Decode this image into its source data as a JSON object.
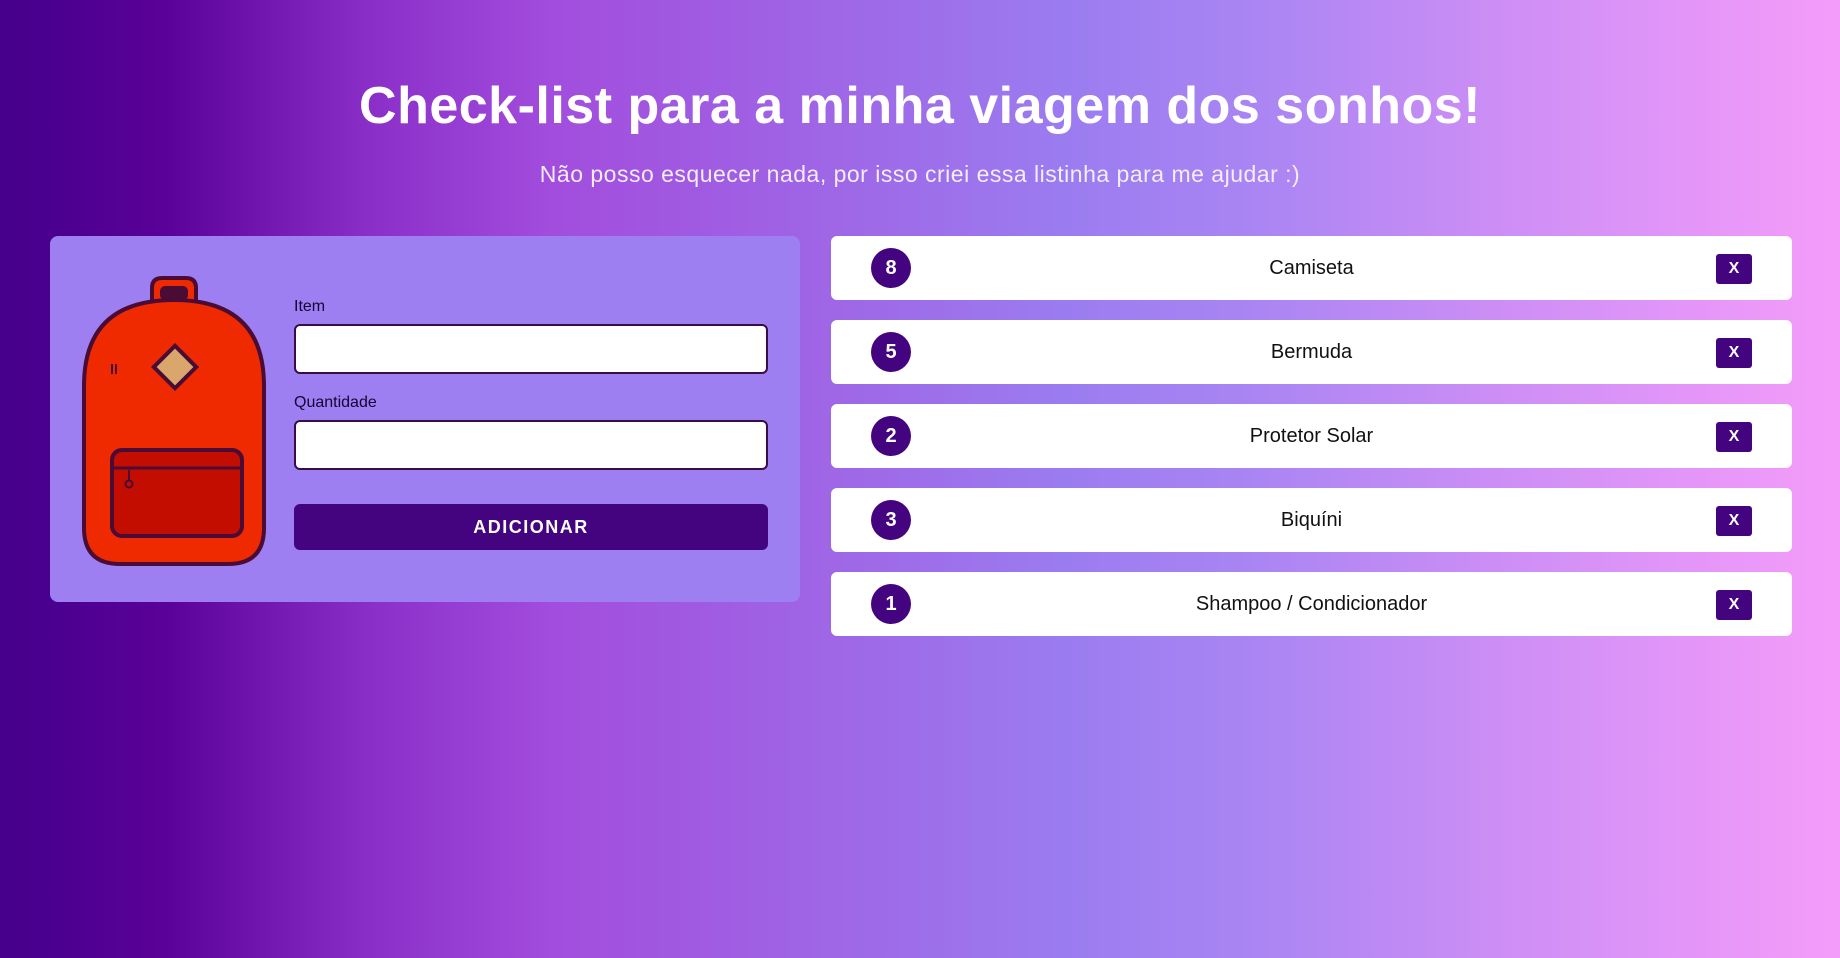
{
  "header": {
    "title": "Check-list para a minha viagem dos sonhos!",
    "subtitle": "Não posso esquecer nada, por isso criei essa listinha para me ajudar :)"
  },
  "form": {
    "item_label": "Item",
    "item_value": "",
    "quantity_label": "Quantidade",
    "quantity_value": "",
    "add_button_label": "ADICIONAR"
  },
  "list": {
    "items": [
      {
        "quantity": "8",
        "name": "Camiseta",
        "delete_label": "X"
      },
      {
        "quantity": "5",
        "name": "Bermuda",
        "delete_label": "X"
      },
      {
        "quantity": "2",
        "name": "Protetor Solar",
        "delete_label": "X"
      },
      {
        "quantity": "3",
        "name": "Biquíni",
        "delete_label": "X"
      },
      {
        "quantity": "1",
        "name": "Shampoo / Condicionador",
        "delete_label": "X"
      }
    ]
  },
  "illustration": {
    "icon": "backpack-icon"
  },
  "colors": {
    "accent": "#44047f",
    "form_card": "#9d7ff2",
    "backpack_body": "#ef2a00",
    "backpack_pocket": "#c20d00",
    "backpack_patch": "#d9a66b",
    "outline": "#4a0b35"
  }
}
